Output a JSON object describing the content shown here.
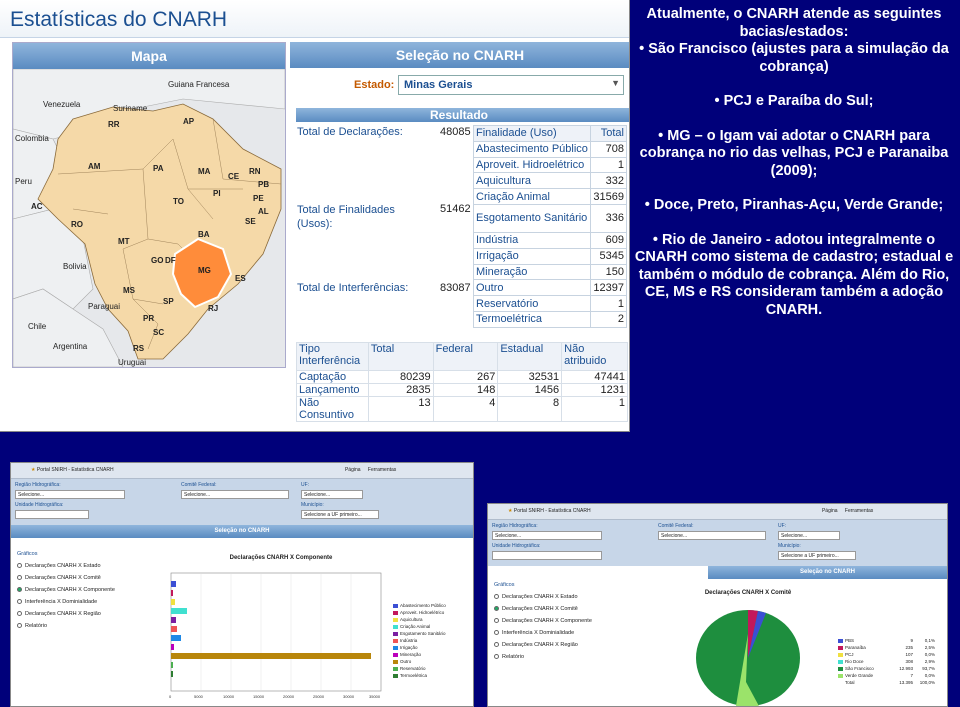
{
  "main": {
    "title": "Estatísticas do CNARH",
    "map_header": "Mapa",
    "selection_header": "Seleção no CNARH",
    "estado_label": "Estado:",
    "estado_value": "Minas Gerais",
    "resultado_header": "Resultado",
    "total_declaracoes_label": "Total de Declarações:",
    "total_declaracoes_value": "48085",
    "total_finalidades_label": "Total de Finalidades (Usos):",
    "total_finalidades_value": "51462",
    "total_interferencias_label": "Total de Interferências:",
    "total_interferencias_value": "83087",
    "map_labels": {
      "venezuela": "Venezuela",
      "colombia": "Colombia",
      "guiana_francesa": "Guiana Francesa",
      "suriname": "Suriname",
      "peru": "Peru",
      "bolivia": "Bolivia",
      "paraguai": "Paraguai",
      "argentina": "Argentina",
      "chile": "Chile",
      "uruguai": "Uruguai",
      "rr": "RR",
      "ap": "AP",
      "am": "AM",
      "pa": "PA",
      "ma": "MA",
      "ce": "CE",
      "rn": "RN",
      "pb": "PB",
      "pi": "PI",
      "pe": "PE",
      "al": "AL",
      "se": "SE",
      "ba": "BA",
      "to": "TO",
      "ac": "AC",
      "ro": "RO",
      "mt": "MT",
      "go": "GO",
      "df": "DF",
      "ms": "MS",
      "mg": "MG",
      "es": "ES",
      "sp": "SP",
      "rj": "RJ",
      "pr": "PR",
      "sc": "SC",
      "rs": "RS"
    },
    "finalidade_table": {
      "headers": [
        "Finalidade (Uso)",
        "Total"
      ],
      "rows": [
        [
          "Abastecimento Público",
          "708"
        ],
        [
          "Aproveit. Hidroelétrico",
          "1"
        ],
        [
          "Aquicultura",
          "332"
        ],
        [
          "Criação Animal",
          "31569"
        ],
        [
          "Esgotamento Sanitário",
          "336"
        ],
        [
          "Indústria",
          "609"
        ],
        [
          "Irrigação",
          "5345"
        ],
        [
          "Mineração",
          "150"
        ],
        [
          "Outro",
          "12397"
        ],
        [
          "Reservatório",
          "1"
        ],
        [
          "Termoelétrica",
          "2"
        ]
      ]
    },
    "interferencia_table": {
      "headers": [
        "Tipo Interferência",
        "Total",
        "Federal",
        "Estadual",
        "Não atribuido"
      ],
      "rows": [
        [
          "Captação",
          "80239",
          "267",
          "32531",
          "47441"
        ],
        [
          "Lançamento",
          "2835",
          "148",
          "1456",
          "1231"
        ],
        [
          "Não Consuntivo",
          "13",
          "4",
          "8",
          "1"
        ]
      ]
    }
  },
  "right_text": {
    "intro": "Atualmente, o CNARH atende as seguintes bacias/estados:",
    "bullets": [
      "• São Francisco (ajustes para a simulação da cobrança)",
      "• PCJ e Paraíba do Sul;",
      "• MG – o Igam vai adotar o CNARH para cobrança no rio das velhas, PCJ e Paranaiba (2009);",
      "• Doce, Preto, Piranhas-Açu, Verde Grande;",
      "• Rio de Janeiro - adotou integralmente o CNARH como sistema de cadastro; estadual e também o módulo de cobrança. Além do Rio, CE, MS e RS consideram também a adoção CNARH."
    ]
  },
  "shot_left": {
    "tab": "Portal SNIRH - Estatística CNARH",
    "toolbar": [
      "Página",
      "Ferramentas"
    ],
    "regiao_label": "Região Hidrográfica:",
    "regiao_value": "Selecione...",
    "comite_label": "Comitê Federal:",
    "comite_value": "Selecione...",
    "uf_label": "UF:",
    "uf_value": "Selecione...",
    "unidade_label": "Unidade Hidrográfica:",
    "municipio_label": "Município:",
    "municipio_value": "Selecione a UF primeiro...",
    "section": "Seleção no CNARH",
    "graficos_label": "Gráficos",
    "radios": [
      "Declarações CNARH X Estado",
      "Declarações CNARH X Comitê",
      "Declarações CNARH X Componente",
      "Interferência X Dominialidade",
      "Declarações CNARH X Região",
      "Relatório"
    ],
    "chart_title": "Declarações CNARH X Componente",
    "x_ticks": [
      "0",
      "5000",
      "10000",
      "15000",
      "20000",
      "25000",
      "30000",
      "35000"
    ],
    "legend": [
      "Abastecimento Público",
      "Aproveit. Hidroelétrico",
      "Aquicultura",
      "Criação Animal",
      "Esgotamento Sanitário",
      "Indústria",
      "Irrigação",
      "Mineração",
      "Outro",
      "Reservatório",
      "Termoelétrica"
    ]
  },
  "shot_right": {
    "tab": "Portal SNIRH - Estatística CNARH",
    "toolbar": [
      "Página",
      "Ferramentas"
    ],
    "regiao_label": "Região Hidrográfica:",
    "regiao_value": "Selecione...",
    "comite_label": "Comitê Federal:",
    "comite_value": "Selecione...",
    "uf_label": "UF:",
    "uf_value": "Selecione...",
    "unidade_label": "Unidade Hidrográfica:",
    "municipio_label": "Município:",
    "municipio_value": "Selecione a UF primeiro...",
    "section": "Seleção no CNARH",
    "graficos_label": "Gráficos",
    "radios": [
      "Declarações CNARH X Estado",
      "Declarações CNARH X Comitê",
      "Declarações CNARH X Componente",
      "Interferência X Dominialidade",
      "Declarações CNARH X Região",
      "Relatório"
    ],
    "chart_title": "Declarações CNARH X Comitê",
    "legend_rows": [
      [
        "PBS",
        "9",
        "0,1%"
      ],
      [
        "Paranaíba",
        "235",
        "2,5%"
      ],
      [
        "PCJ",
        "107",
        "0,0%"
      ],
      [
        "Rio Doce",
        "308",
        "2,9%"
      ],
      [
        "São Francisco",
        "12.993",
        "93,7%"
      ],
      [
        "Verde Grande",
        "7",
        "0,0%"
      ],
      [
        "Total",
        "13.395",
        "100,0%"
      ]
    ]
  },
  "colors": {
    "background": "#00007a",
    "highlight_state": "#ff8c3a",
    "brazil": "#f5d9a8",
    "header_blue": "#5a8bc1"
  }
}
